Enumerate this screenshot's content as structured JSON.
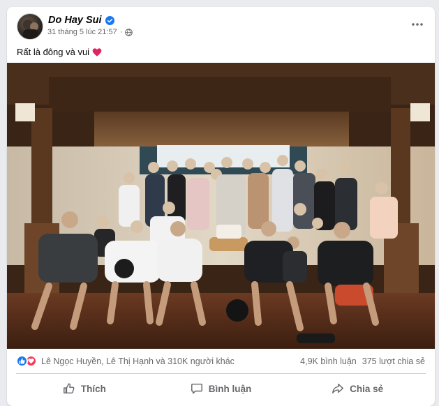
{
  "post": {
    "author": "Do Hay Sui",
    "timestamp": "31 tháng 5 lúc 21:57",
    "privacy_icon": "globe-icon",
    "verified": true,
    "caption": "Rất là đông và vui",
    "caption_emoji": "red-heart",
    "more_icon": "more-options-icon"
  },
  "stats": {
    "reaction_icons": [
      "like",
      "love"
    ],
    "reactors": "Lê Ngọc Huyền, Lê Thị Hạnh và 310K người khác",
    "comments": "4,9K bình luận",
    "shares": "375 lượt chia sẻ"
  },
  "actions": {
    "like": "Thích",
    "comment": "Bình luận",
    "share": "Chia sẻ"
  },
  "colors": {
    "brand_blue": "#1877f2",
    "love_red": "#f33e58",
    "secondary_text": "#65676b"
  }
}
